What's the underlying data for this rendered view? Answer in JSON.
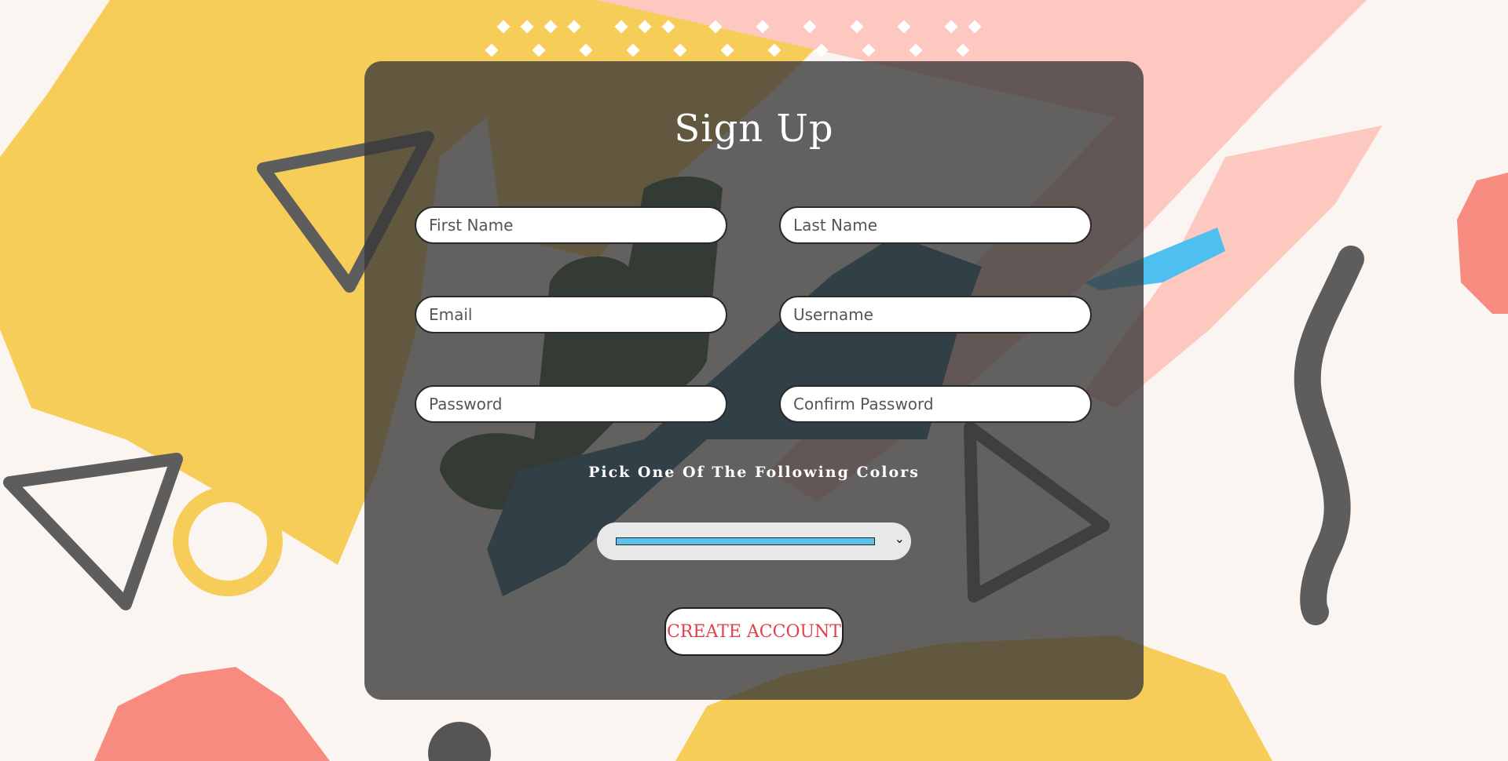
{
  "form": {
    "title": "Sign Up",
    "first_name_placeholder": "First Name",
    "last_name_placeholder": "Last Name",
    "email_placeholder": "Email",
    "username_placeholder": "Username",
    "password_placeholder": "Password",
    "confirm_password_placeholder": "Confirm Password",
    "color_prompt": "Pick One Of The Following Colors",
    "selected_color": "#5bc0eb",
    "submit_label": "CREATE ACCOUNT"
  },
  "icons": {
    "select_chevron": "chevron-down-icon"
  },
  "colors": {
    "panel_overlay": "rgba(55,55,55,0.78)",
    "submit_text": "#e0424a",
    "background_yellow": "#f7cd5a",
    "background_pink": "#fcc8c0",
    "background_coral": "#f88b80",
    "background_blue": "#4fbff0",
    "background_cream": "#fbf5f1"
  }
}
